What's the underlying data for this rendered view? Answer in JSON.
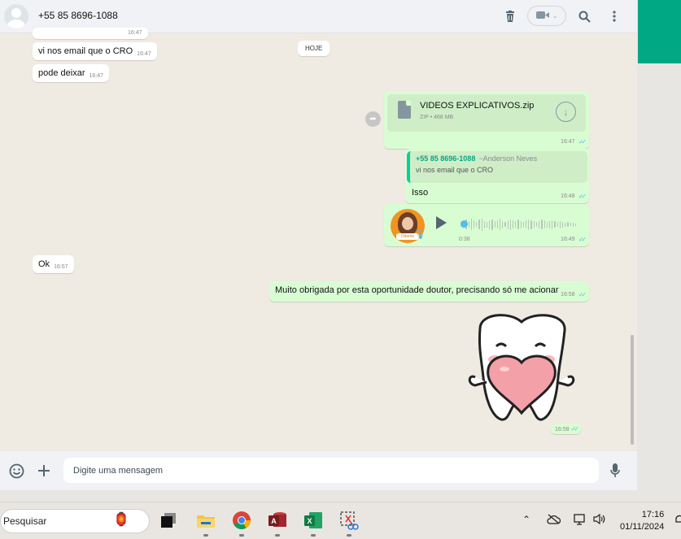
{
  "header": {
    "contact_name": "+55 85 8696-1088",
    "icons": [
      "avatar",
      "trash-icon",
      "video-call-icon",
      "chevron-down-icon",
      "search-icon",
      "menu-dots-icon"
    ]
  },
  "chat": {
    "messages_in": [
      {
        "text": "vi nos email que o CRO",
        "time": "16:47"
      },
      {
        "text": "pode deixar",
        "time": "16:47"
      },
      {
        "text": "Ok",
        "time": "16:57"
      }
    ],
    "partial_time": "16:47",
    "date_chip": "HOJE",
    "file": {
      "name": "VIDEOS EXPLICATIVOS.zip",
      "meta": "ZIP • 468 MB",
      "time": "16:47"
    },
    "reply": {
      "quoted_author": "+55 85 8696-1088",
      "quoted_author_alias": "~Anderson Neves",
      "quoted_text": "vi nos email que o CRO",
      "text": "Isso",
      "time": "16:48"
    },
    "voice": {
      "duration": "0:38",
      "time": "16:49",
      "avatar_badge": "Odonto"
    },
    "long_out": {
      "text": "Muito obrigada por esta oportunidade doutor, precisando só me acionar",
      "time": "16:58"
    },
    "sticker_time": "16:58"
  },
  "composer": {
    "placeholder": "Digite uma mensagem"
  },
  "taskbar": {
    "search_label": "Pesquisar",
    "time": "17:16",
    "date": "01/11/2024",
    "apps": [
      "task-view",
      "file-explorer",
      "chrome",
      "access",
      "excel",
      "snipping-tool"
    ]
  },
  "colors": {
    "accent": "#00a884",
    "outgoing_bubble": "#d9fdd3",
    "chat_bg": "#efeae2",
    "read_ticks": "#53bdeb"
  }
}
